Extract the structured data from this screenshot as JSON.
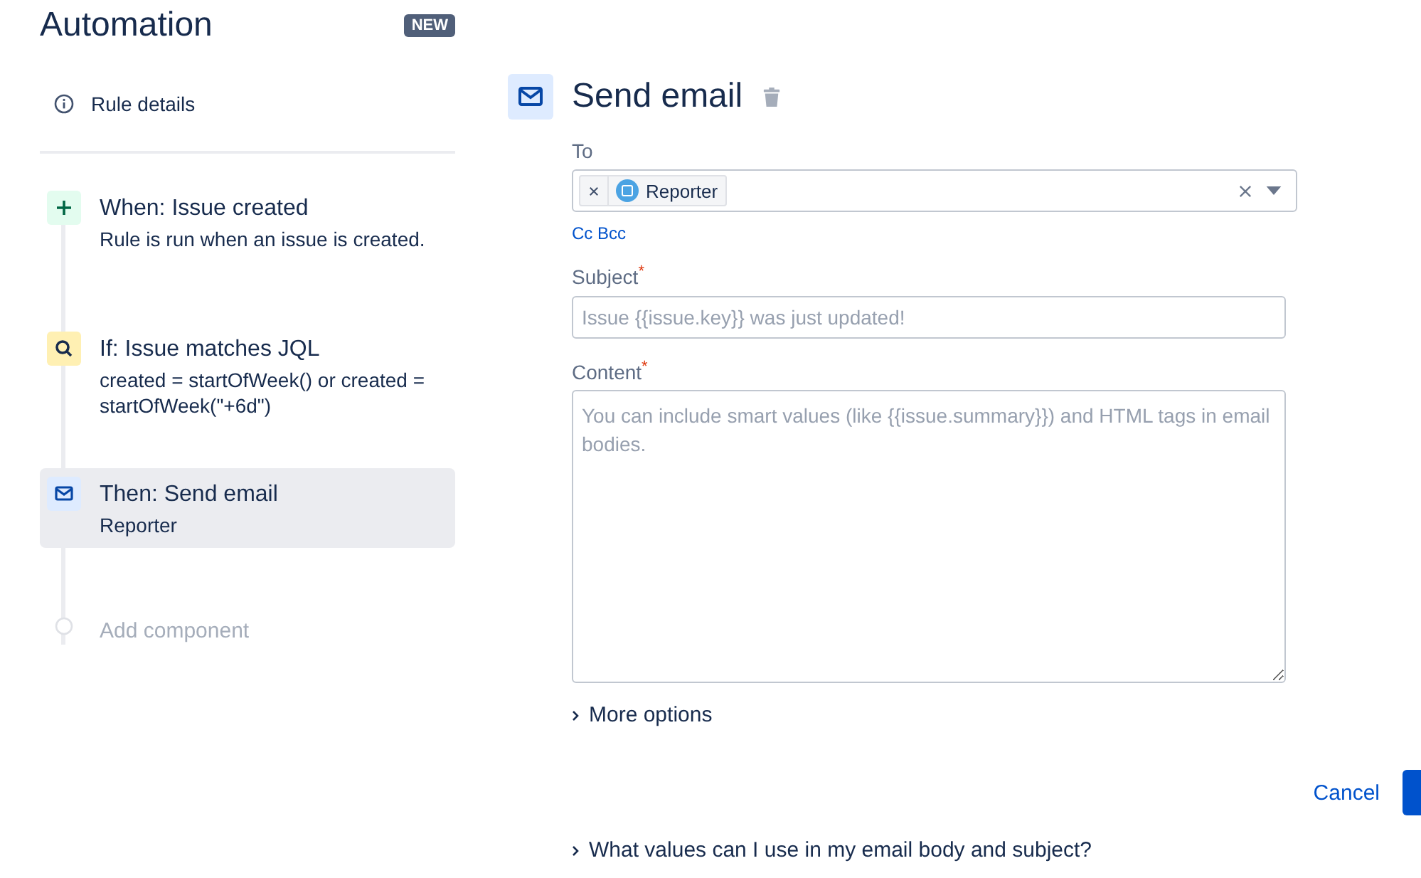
{
  "app": {
    "title": "Automation",
    "badge": "NEW"
  },
  "rule_details": {
    "label": "Rule details"
  },
  "steps": [
    {
      "kind": "trigger",
      "title": "When: Issue created",
      "description": "Rule is run when an issue is created.",
      "selected": false
    },
    {
      "kind": "condition",
      "title": "If: Issue matches JQL",
      "description": "created = startOfWeek() or created = startOfWeek(\"+6d\")",
      "selected": false
    },
    {
      "kind": "action",
      "title": "Then: Send email",
      "description": "Reporter",
      "selected": true
    },
    {
      "kind": "add",
      "title": "Add component",
      "selected": false
    }
  ],
  "editor": {
    "title": "Send email",
    "to": {
      "label": "To",
      "chips": [
        {
          "label": "Reporter"
        }
      ]
    },
    "cc_bcc": "Cc Bcc",
    "subject": {
      "label": "Subject",
      "required_mark": "*",
      "placeholder": "Issue {{issue.key}} was just updated!"
    },
    "content": {
      "label": "Content",
      "required_mark": "*",
      "placeholder": "You can include smart values (like {{issue.summary}}) and HTML tags in email bodies."
    },
    "more_options": "More options",
    "cancel": "Cancel",
    "help": "What values can I use in my email body and subject?"
  }
}
